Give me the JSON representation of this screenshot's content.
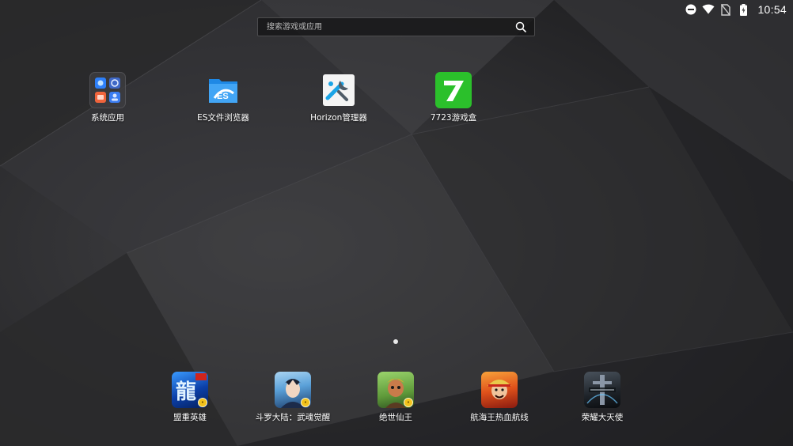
{
  "status_bar": {
    "time": "10:54",
    "icons": [
      "do-not-disturb-icon",
      "wifi-icon",
      "no-sim-icon",
      "battery-charging-icon"
    ]
  },
  "search": {
    "placeholder": "搜索游戏或应用",
    "value": ""
  },
  "apps": [
    {
      "label": "系统应用",
      "icon": "folder-icon"
    },
    {
      "label": "ES文件浏览器",
      "icon": "es-file-explorer-icon"
    },
    {
      "label": "Horizon管理器",
      "icon": "horizon-manager-icon"
    },
    {
      "label": "7723游戏盒",
      "icon": "game-box-7723-icon"
    }
  ],
  "dock_apps": [
    {
      "label": "盟重英雄",
      "icon": "game-icon"
    },
    {
      "label": "斗罗大陆：武魂觉醒",
      "icon": "game-icon"
    },
    {
      "label": "绝世仙王",
      "icon": "game-icon"
    },
    {
      "label": "航海王热血航线",
      "icon": "game-icon"
    },
    {
      "label": "荣耀大天使",
      "icon": "game-icon"
    }
  ],
  "page_indicator": {
    "current": 1,
    "total": 1
  },
  "colors": {
    "wallpaper_dark": "#1e1e20",
    "wallpaper_light": "#4a4a4c",
    "es_blue": "#1e88e5",
    "game_box_green": "#2bc02b",
    "badge_yellow": "#f3c21b"
  }
}
